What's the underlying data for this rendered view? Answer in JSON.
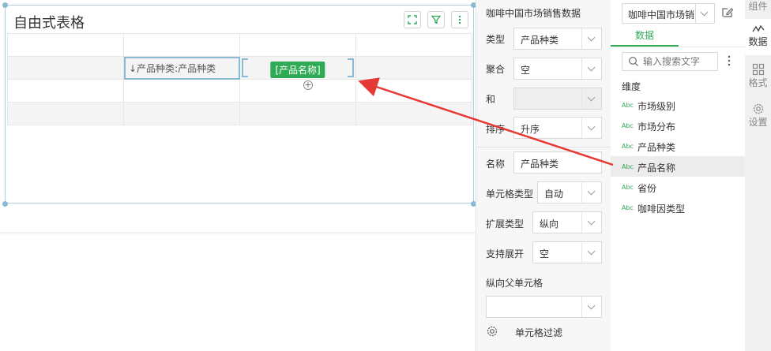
{
  "widget": {
    "title": "自由式表格",
    "cells": {
      "r2c2": "↓产品种类:产品种类",
      "r2c3_chip": "[产品名称]"
    }
  },
  "props": {
    "dataset_title": "咖啡中国市场销售数据",
    "rows": {
      "type": {
        "label": "类型",
        "value": "产品种类"
      },
      "agg": {
        "label": "聚合",
        "value": "空"
      },
      "sum": {
        "label": "和",
        "value": ""
      },
      "sort": {
        "label": "排序",
        "value": "升序"
      },
      "name": {
        "label": "名称",
        "value": "产品种类"
      },
      "cell_type": {
        "label": "单元格类型",
        "value": "自动"
      },
      "expand_type": {
        "label": "扩展类型",
        "value": "纵向"
      },
      "support_expand": {
        "label": "支持展开",
        "value": "空"
      },
      "parent_cell": {
        "label": "纵向父单元格",
        "value": ""
      }
    },
    "cell_filter": "单元格过滤"
  },
  "datapanel": {
    "dataset_select": "咖啡中国市场销",
    "tab_label": "数据",
    "search_placeholder": "输入搜索文字",
    "section": "维度",
    "type_badge": "Abc",
    "fields": [
      "市场级别",
      "市场分布",
      "产品种类",
      "产品名称",
      "省份",
      "咖啡因类型"
    ],
    "active_field_index": 3
  },
  "sidetabs": [
    {
      "label": "组件",
      "icon": "component-icon"
    },
    {
      "label": "数据",
      "icon": "data-chart-icon"
    },
    {
      "label": "格式",
      "icon": "format-grid-icon"
    },
    {
      "label": "设置",
      "icon": "settings-gear-icon"
    }
  ],
  "colors": {
    "accent": "#2faa55",
    "selection": "#8ab9d4",
    "arrow": "#e53935"
  }
}
